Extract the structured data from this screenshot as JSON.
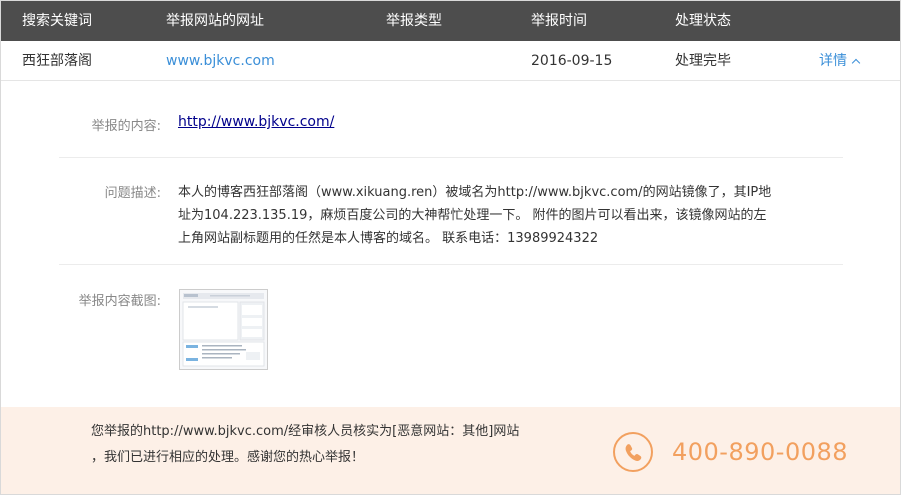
{
  "table": {
    "headers": [
      "搜索关键词",
      "举报网站的网址",
      "举报类型",
      "举报时间",
      "处理状态"
    ],
    "row": {
      "keyword": "西狂部落阁",
      "site": "www.bjkvc.com",
      "type": "",
      "time": "2016-09-15",
      "status": "处理完毕",
      "detail_label": "详情"
    }
  },
  "detail": {
    "content_label": "举报的内容:",
    "content_url": "http://www.bjkvc.com/",
    "desc_label": "问题描述:",
    "desc_text": "本人的博客西狂部落阁（www.xikuang.ren）被域名为http://www.bjkvc.com/的网站镜像了，其IP地址为104.223.135.19，麻烦百度公司的大神帮忙处理一下。 附件的图片可以看出来，该镜像网站的左上角网站副标题用的任然是本人博客的域名。 联系电话：13989924322",
    "screenshot_label": "举报内容截图:"
  },
  "footer": {
    "line1": "您举报的http://www.bjkvc.com/经审核人员核实为[恶意网站：其他]网站",
    "line2": "，我们已进行相应的处理。感谢您的热心举报！",
    "phone": "400-890-0088",
    "phone_icon": "phone-icon"
  },
  "colors": {
    "header_bg": "#4d4d4d",
    "link": "#3b8fd8",
    "accent": "#f2a05f",
    "footer_bg": "#fdf0e7"
  }
}
